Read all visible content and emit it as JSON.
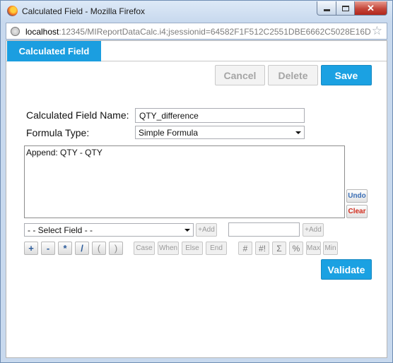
{
  "window": {
    "title": "Calculated Field - Mozilla Firefox",
    "url_host": "localhost",
    "url_rest": ":12345/MIReportDataCalc.i4;jsessionid=64582F1F512C2551DBE6662C5028E16D"
  },
  "tab": {
    "label": "Calculated Field"
  },
  "toolbar": {
    "cancel": "Cancel",
    "delete": "Delete",
    "save": "Save"
  },
  "form": {
    "name_label": "Calculated Field Name:",
    "name_value": "QTY_difference",
    "formula_type_label": "Formula Type:",
    "formula_type_value": "Simple Formula",
    "formula_text": "Append: QTY - QTY",
    "undo": "Undo",
    "clear": "Clear",
    "select_field": "- - Select Field - -",
    "add1": "+Add",
    "add2": "+Add",
    "validate": "Validate"
  },
  "operators": [
    "+",
    "-",
    "*",
    "/",
    "(",
    ")"
  ],
  "keywords": [
    "Case",
    "When",
    "Else",
    "End"
  ],
  "functions": [
    "#",
    "#!",
    "Σ",
    "%",
    "Max",
    "Min"
  ]
}
